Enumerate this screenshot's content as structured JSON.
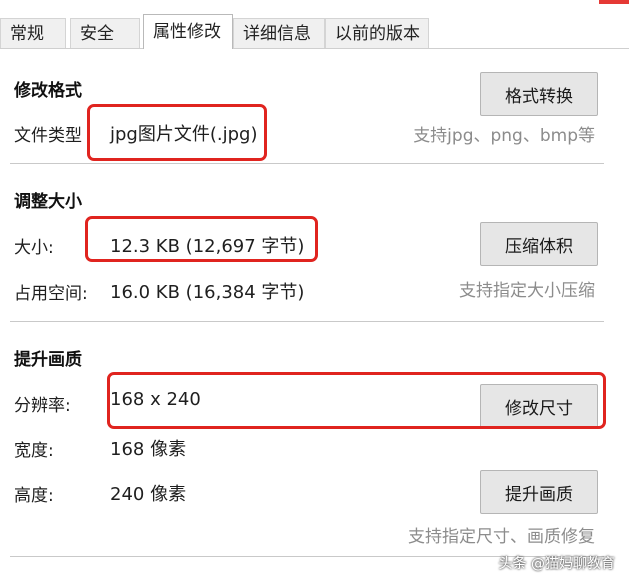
{
  "tabs": [
    {
      "label": "常规"
    },
    {
      "label": "安全"
    },
    {
      "label": "属性修改"
    },
    {
      "label": "详细信息"
    },
    {
      "label": "以前的版本"
    }
  ],
  "format_section": {
    "title": "修改格式",
    "file_type_label": "文件类型",
    "file_type_value": "jpg图片文件(.jpg)",
    "convert_button": "格式转换",
    "hint": "支持jpg、png、bmp等"
  },
  "size_section": {
    "title": "调整大小",
    "size_label": "大小:",
    "size_value": "12.3 KB (12,697 字节)",
    "disk_label": "占用空间:",
    "disk_value": "16.0 KB (16,384 字节)",
    "compress_button": "压缩体积",
    "hint": "支持指定大小压缩"
  },
  "quality_section": {
    "title": "提升画质",
    "resolution_label": "分辨率:",
    "resolution_value": "168 x 240",
    "resize_button": "修改尺寸",
    "width_label": "宽度:",
    "width_value": "168 像素",
    "height_label": "高度:",
    "height_value": "240 像素",
    "enhance_button": "提升画质",
    "hint": "支持指定尺寸、画质修复"
  },
  "watermark": "头条 @猫妈聊教育",
  "colors": {
    "highlight": "#e0241f",
    "hint_text": "#8c8c8c",
    "button_bg": "#e6e6e6"
  }
}
